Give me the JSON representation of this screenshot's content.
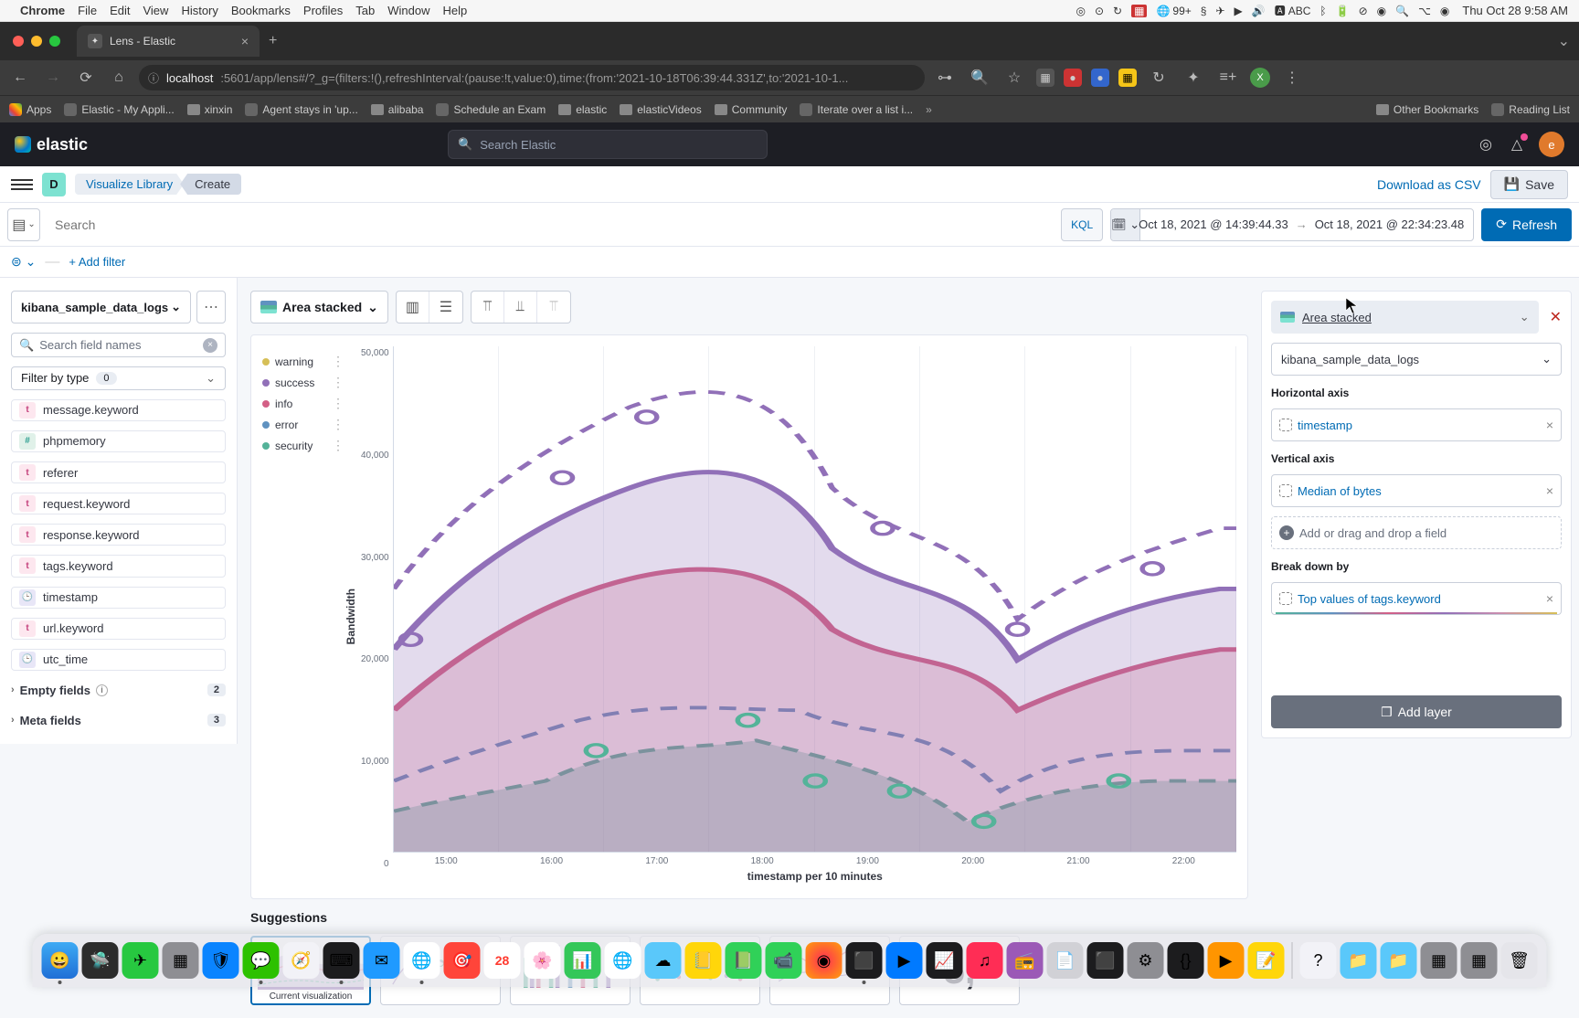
{
  "menubar": {
    "app": "Chrome",
    "items": [
      "File",
      "Edit",
      "View",
      "History",
      "Bookmarks",
      "Profiles",
      "Tab",
      "Window",
      "Help"
    ],
    "notif_badge": "99+",
    "battery": "",
    "abc": "ABC",
    "clock": "Thu Oct 28  9:58 AM"
  },
  "tab": {
    "title": "Lens - Elastic"
  },
  "url": {
    "host": "localhost",
    "path": ":5601/app/lens#/?_g=(filters:!(),refreshInterval:(pause:!t,value:0),time:(from:'2021-10-18T06:39:44.331Z',to:'2021-10-1..."
  },
  "avatar_letter": "X",
  "bookmarks": [
    "Apps",
    "Elastic - My Appli...",
    "xinxin",
    "Agent stays in 'up...",
    "alibaba",
    "Schedule an Exam",
    "elastic",
    "elasticVideos",
    "Community",
    "Iterate over a list i...",
    "»",
    "Other Bookmarks",
    "Reading List"
  ],
  "elastic": {
    "brand": "elastic",
    "search_placeholder": "Search Elastic",
    "user_initial": "e"
  },
  "breadcrumb": {
    "space_initial": "D",
    "lib": "Visualize Library",
    "create": "Create"
  },
  "actions": {
    "download_csv": "Download as CSV",
    "save": "Save"
  },
  "query": {
    "placeholder": "Search",
    "kql": "KQL",
    "from": "Oct 18, 2021 @ 14:39:44.33",
    "to": "Oct 18, 2021 @ 22:34:23.48",
    "refresh": "Refresh"
  },
  "filter": {
    "add": "+ Add filter"
  },
  "index_pattern": "kibana_sample_data_logs",
  "search_fields_placeholder": "Search field names",
  "filter_by_type": {
    "label": "Filter by type",
    "count": "0"
  },
  "fields": [
    {
      "name": "message.keyword",
      "type": "t"
    },
    {
      "name": "phpmemory",
      "type": "n"
    },
    {
      "name": "referer",
      "type": "t"
    },
    {
      "name": "request.keyword",
      "type": "t"
    },
    {
      "name": "response.keyword",
      "type": "t"
    },
    {
      "name": "tags.keyword",
      "type": "t"
    },
    {
      "name": "timestamp",
      "type": "d"
    },
    {
      "name": "url.keyword",
      "type": "t"
    },
    {
      "name": "utc_time",
      "type": "d"
    }
  ],
  "empty_fields": {
    "label": "Empty fields",
    "count": "2"
  },
  "meta_fields": {
    "label": "Meta fields",
    "count": "3"
  },
  "chart_type_label": "Area stacked",
  "legend_items": [
    {
      "label": "warning",
      "color": "#d6bf57"
    },
    {
      "label": "success",
      "color": "#9170b8"
    },
    {
      "label": "info",
      "color": "#d36086"
    },
    {
      "label": "error",
      "color": "#6092c0"
    },
    {
      "label": "security",
      "color": "#54b399"
    }
  ],
  "y_label": "Bandwidth",
  "y_ticks": [
    "50,000",
    "40,000",
    "30,000",
    "20,000",
    "10,000",
    "0"
  ],
  "x_label": "timestamp per 10 minutes",
  "x_ticks": [
    "15:00",
    "16:00",
    "17:00",
    "18:00",
    "19:00",
    "20:00",
    "21:00",
    "22:00"
  ],
  "suggestions_label": "Suggestions",
  "sugg_current": "Current visualization",
  "sugg_metric": "5,",
  "config": {
    "layer_type": "Area stacked",
    "layer_ds": "kibana_sample_data_logs",
    "h_axis_label": "Horizontal axis",
    "h_axis_value": "timestamp",
    "v_axis_label": "Vertical axis",
    "v_axis_value": "Median of bytes",
    "empty_drop": "Add or drag and drop a field",
    "breakdown_label": "Break down by",
    "breakdown_value": "Top values of tags.keyword",
    "add_layer": "Add layer"
  },
  "chart_data": {
    "type": "area",
    "stacked": true,
    "xlabel": "timestamp per 10 minutes",
    "ylabel": "Bandwidth",
    "ylim": [
      0,
      50000
    ],
    "categories": [
      "15:00",
      "16:00",
      "17:00",
      "18:00",
      "19:00",
      "20:00",
      "21:00",
      "22:00"
    ],
    "series": [
      {
        "name": "security",
        "color": "#54b399",
        "values": [
          4000,
          6000,
          7000,
          11000,
          9000,
          8000,
          3000,
          7000
        ]
      },
      {
        "name": "error",
        "color": "#6092c0",
        "values": [
          7000,
          10000,
          12000,
          14000,
          11000,
          13000,
          6000,
          10000
        ]
      },
      {
        "name": "info",
        "color": "#d36086",
        "values": [
          14000,
          22000,
          26000,
          28000,
          22000,
          18000,
          14000,
          20000
        ]
      },
      {
        "name": "success",
        "color": "#9170b8",
        "values": [
          20000,
          30000,
          34000,
          38000,
          28000,
          24000,
          18000,
          26000
        ]
      },
      {
        "name": "warning",
        "color": "#d6bf57",
        "values": [
          26000,
          38000,
          42000,
          46000,
          35000,
          30000,
          23000,
          32000
        ]
      }
    ],
    "note": "Solid and dashed-outline pair per series; values approximate from gridlines."
  }
}
